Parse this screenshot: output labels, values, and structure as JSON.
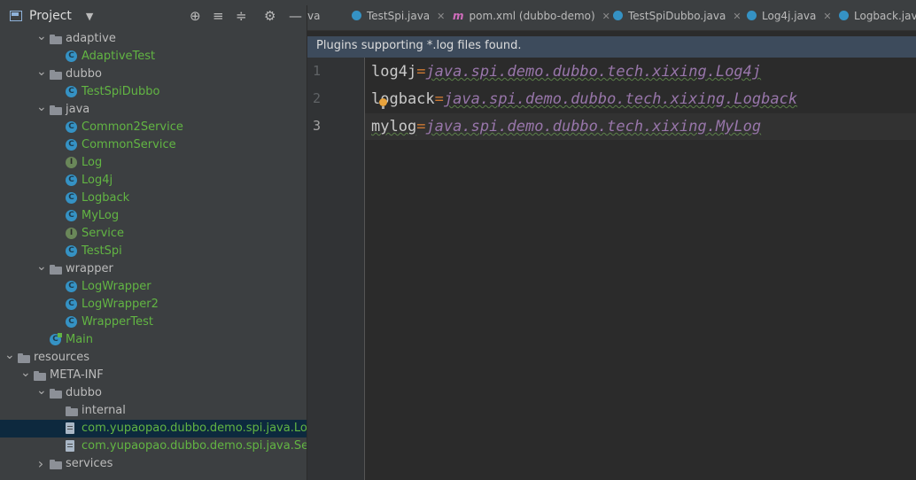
{
  "project_panel": {
    "title": "Project",
    "tree": [
      {
        "label": "adaptive",
        "kind": "folder",
        "expanded": true
      },
      {
        "label": "AdaptiveTest",
        "kind": "class"
      },
      {
        "label": "dubbo",
        "kind": "folder",
        "expanded": true
      },
      {
        "label": "TestSpiDubbo",
        "kind": "class"
      },
      {
        "label": "java",
        "kind": "folder",
        "expanded": true
      },
      {
        "label": "Common2Service",
        "kind": "class"
      },
      {
        "label": "CommonService",
        "kind": "class"
      },
      {
        "label": "Log",
        "kind": "interface"
      },
      {
        "label": "Log4j",
        "kind": "class"
      },
      {
        "label": "Logback",
        "kind": "class"
      },
      {
        "label": "MyLog",
        "kind": "class"
      },
      {
        "label": "Service",
        "kind": "interface"
      },
      {
        "label": "TestSpi",
        "kind": "class"
      },
      {
        "label": "wrapper",
        "kind": "folder",
        "expanded": true
      },
      {
        "label": "LogWrapper",
        "kind": "class"
      },
      {
        "label": "LogWrapper2",
        "kind": "class"
      },
      {
        "label": "WrapperTest",
        "kind": "class"
      },
      {
        "label": "Main",
        "kind": "main-class"
      },
      {
        "label": "resources",
        "kind": "folder",
        "expanded": true
      },
      {
        "label": "META-INF",
        "kind": "folder",
        "expanded": true
      },
      {
        "label": "dubbo",
        "kind": "folder",
        "expanded": true
      },
      {
        "label": "internal",
        "kind": "folder"
      },
      {
        "label": "com.yupaopao.dubbo.demo.spi.java.Log",
        "kind": "file",
        "selected": true
      },
      {
        "label": "com.yupaopao.dubbo.demo.spi.java.Ser",
        "kind": "file"
      },
      {
        "label": "services",
        "kind": "folder",
        "expanded": false
      }
    ]
  },
  "tabs": [
    {
      "label": "va",
      "icon": "none"
    },
    {
      "label": "TestSpi.java",
      "icon": "class"
    },
    {
      "label": "pom.xml (dubbo-demo)",
      "icon": "maven"
    },
    {
      "label": "TestSpiDubbo.java",
      "icon": "class"
    },
    {
      "label": "Log4j.java",
      "icon": "class"
    },
    {
      "label": "Logback.java",
      "icon": "class"
    }
  ],
  "banner": "Plugins supporting *.log files found.",
  "editor": {
    "lines": [
      {
        "num": "1",
        "key": "log4j",
        "value": "java.spi.demo.dubbo.tech.xixing.Log4j"
      },
      {
        "num": "2",
        "key": "logback",
        "value": "java.spi.demo.dubbo.tech.xixing.Logback"
      },
      {
        "num": "3",
        "key": "mylog",
        "value": "java.spi.demo.dubbo.tech.xixing.MyLog"
      }
    ]
  }
}
